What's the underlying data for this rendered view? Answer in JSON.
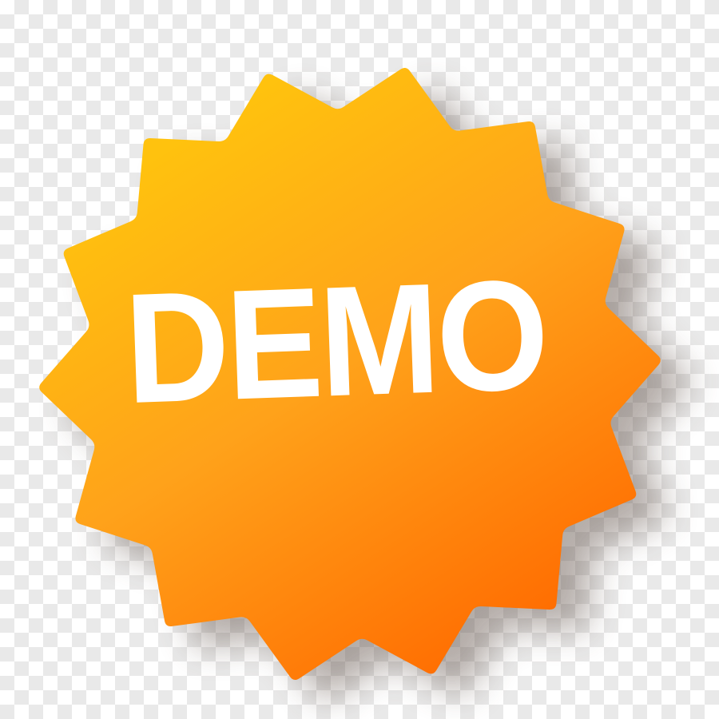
{
  "badge": {
    "label": "DEMO"
  },
  "colors": {
    "badge_light": "#FFC20E",
    "badge_mid": "#FFA21A",
    "badge_dark": "#FF6A00",
    "text": "#FFFFFF",
    "checker": "#E9E9E9"
  },
  "icons": {
    "badge_shape": "starburst-badge"
  }
}
